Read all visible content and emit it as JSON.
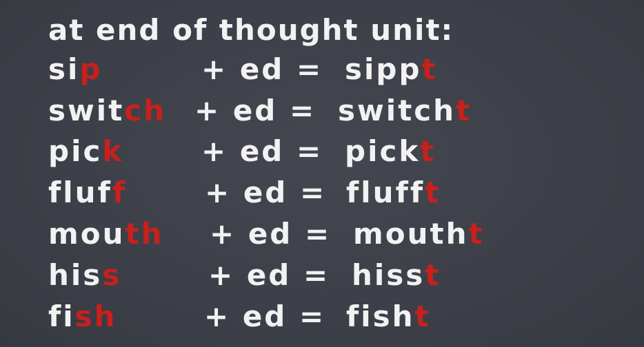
{
  "slide": {
    "title": "at end of thought unit:",
    "rows": [
      {
        "base_plain": "si",
        "base_red": "p",
        "operator": "+ ed =",
        "result_plain": "sipp",
        "result_red": "t"
      },
      {
        "base_plain": "swit",
        "base_red": "ch",
        "operator": "+ ed =",
        "result_plain": "switch",
        "result_red": "t"
      },
      {
        "base_plain": "pic",
        "base_red": "k",
        "operator": "+ ed =",
        "result_plain": "pick",
        "result_red": "t"
      },
      {
        "base_plain": "fluf",
        "base_red": "f",
        "operator": "+ ed =",
        "result_plain": "flufft",
        "result_red": ""
      },
      {
        "base_plain": "mou",
        "base_red": "th",
        "operator": "+ ed =",
        "result_plain": "mouth",
        "result_red": "t"
      },
      {
        "base_plain": "his",
        "base_red": "s",
        "operator": "+ ed =",
        "result_plain": "hiss",
        "result_red": "t"
      },
      {
        "base_plain": "fi",
        "base_red": "sh",
        "operator": "+ ed =",
        "result_plain": "fish",
        "result_red": "t"
      }
    ],
    "accent_color": "#c8201c",
    "background_color": "#3d4048",
    "text_color": "#f2f2f2"
  }
}
